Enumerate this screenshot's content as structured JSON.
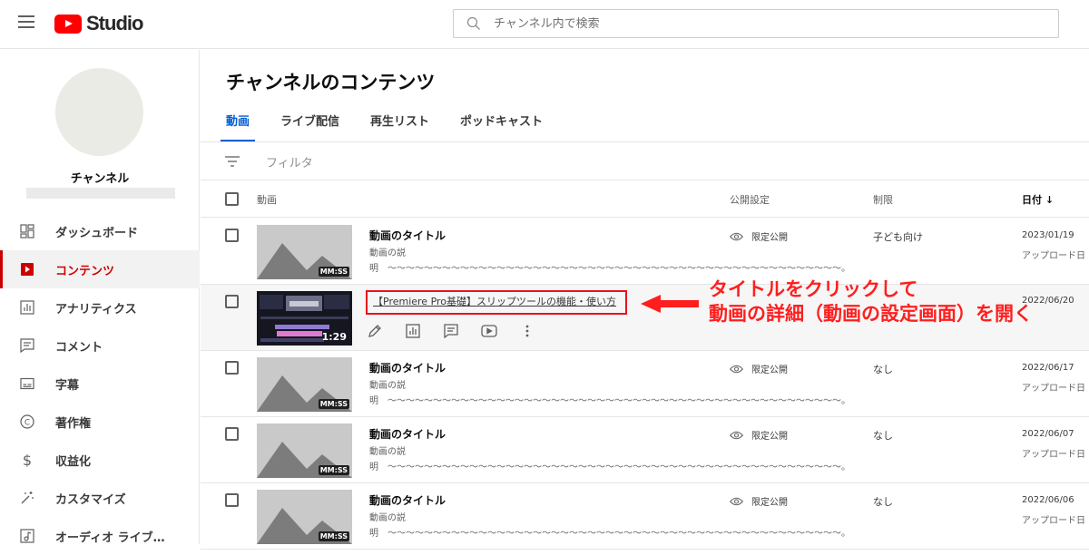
{
  "header": {
    "logo_text": "Studio",
    "search_placeholder": "チャンネル内で検索"
  },
  "sidebar": {
    "channel_name": "チャンネル",
    "items": [
      {
        "label": "ダッシュボード",
        "icon": "dashboard-icon"
      },
      {
        "label": "コンテンツ",
        "icon": "content-play-icon",
        "active": true
      },
      {
        "label": "アナリティクス",
        "icon": "analytics-icon"
      },
      {
        "label": "コメント",
        "icon": "comment-icon"
      },
      {
        "label": "字幕",
        "icon": "subtitles-icon"
      },
      {
        "label": "著作権",
        "icon": "copyright-icon"
      },
      {
        "label": "収益化",
        "icon": "dollar-icon"
      },
      {
        "label": "カスタマイズ",
        "icon": "magic-wand-icon"
      },
      {
        "label": "オーディオ ライブ…",
        "icon": "audio-library-icon"
      }
    ]
  },
  "main": {
    "title": "チャンネルのコンテンツ",
    "tabs": [
      {
        "label": "動画",
        "active": true
      },
      {
        "label": "ライブ配信"
      },
      {
        "label": "再生リスト"
      },
      {
        "label": "ポッドキャスト"
      }
    ],
    "filter_label": "フィルタ",
    "columns": {
      "video": "動画",
      "visibility": "公開設定",
      "restriction": "制限",
      "date": "日付 ↓"
    },
    "rows": [
      {
        "title": "動画のタイトル",
        "desc": "動画の説明　〜〜〜〜〜〜〜〜〜〜〜〜〜〜〜〜〜〜〜〜〜〜〜〜〜〜〜〜〜〜〜〜〜〜〜〜〜〜〜〜〜〜〜〜〜〜〜〜〜〜。",
        "duration": "MM:SS",
        "visibility": "限定公開",
        "restriction": "子ども向け",
        "date": "2023/01/19",
        "sub": "アップロード日"
      },
      {
        "title": "動画のタイトル",
        "desc": "動画の説明　〜〜〜〜〜〜〜〜〜〜〜〜〜〜〜〜〜〜〜〜〜〜〜〜〜〜〜〜〜〜〜〜〜〜〜〜〜〜〜〜〜〜〜〜〜〜〜〜〜〜。",
        "duration": "MM:SS",
        "visibility": "限定公開",
        "restriction": "なし",
        "date": "2022/06/17",
        "sub": "アップロード日"
      },
      {
        "title": "動画のタイトル",
        "desc": "動画の説明　〜〜〜〜〜〜〜〜〜〜〜〜〜〜〜〜〜〜〜〜〜〜〜〜〜〜〜〜〜〜〜〜〜〜〜〜〜〜〜〜〜〜〜〜〜〜〜〜〜〜。",
        "duration": "MM:SS",
        "visibility": "限定公開",
        "restriction": "なし",
        "date": "2022/06/07",
        "sub": "アップロード日"
      },
      {
        "title": "動画のタイトル",
        "desc": "動画の説明　〜〜〜〜〜〜〜〜〜〜〜〜〜〜〜〜〜〜〜〜〜〜〜〜〜〜〜〜〜〜〜〜〜〜〜〜〜〜〜〜〜〜〜〜〜〜〜〜〜〜。",
        "duration": "MM:SS",
        "visibility": "限定公開",
        "restriction": "なし",
        "date": "2022/06/06",
        "sub": "アップロード日"
      }
    ],
    "highlight_row": {
      "title": "【Premiere Pro基礎】スリップツールの機能・使い方",
      "duration": "1:29",
      "date_partial": "2022/06/20",
      "actions": [
        "pencil-icon",
        "analytics-icon",
        "comment-icon",
        "youtube-play-icon",
        "more-vert-icon"
      ]
    }
  },
  "annotation": {
    "line1": "タイトルをクリックして",
    "line2": "動画の詳細（動画の設定画面）を開く",
    "color": "#ff1e1e"
  }
}
